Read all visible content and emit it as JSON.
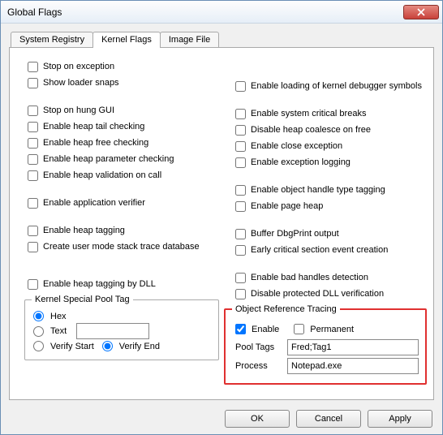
{
  "window": {
    "title": "Global Flags"
  },
  "tabs": {
    "system_registry": "System Registry",
    "kernel_flags": "Kernel Flags",
    "image_file": "Image File",
    "active": "kernel_flags"
  },
  "flags_left": {
    "stop_on_exception": "Stop on exception",
    "show_loader_snaps": "Show loader snaps",
    "stop_on_hung_gui": "Stop on hung GUI",
    "enable_heap_tail_checking": "Enable heap tail checking",
    "enable_heap_free_checking": "Enable heap free checking",
    "enable_heap_parameter_checking": "Enable heap parameter checking",
    "enable_heap_validation_on_call": "Enable heap validation on call",
    "enable_application_verifier": "Enable application verifier",
    "enable_heap_tagging": "Enable heap tagging",
    "create_user_mode_stack_trace_db": "Create user mode stack trace database",
    "enable_heap_tagging_by_dll": "Enable heap tagging by DLL"
  },
  "flags_right": {
    "enable_loading_kernel_debugger_symbols": "Enable loading of kernel debugger symbols",
    "enable_system_critical_breaks": "Enable system critical breaks",
    "disable_heap_coalesce_on_free": "Disable heap coalesce on free",
    "enable_close_exception": "Enable close exception",
    "enable_exception_logging": "Enable exception logging",
    "enable_object_handle_type_tagging": "Enable object handle type tagging",
    "enable_page_heap": "Enable page heap",
    "buffer_dbgprint_output": "Buffer DbgPrint output",
    "early_critical_section_event_creation": "Early critical section event creation",
    "enable_bad_handles_detection": "Enable bad handles detection",
    "disable_protected_dll_verification": "Disable protected DLL verification"
  },
  "kernel_special_pool_tag": {
    "legend": "Kernel Special Pool Tag",
    "hex": "Hex",
    "text": "Text",
    "verify_start": "Verify Start",
    "verify_end": "Verify End",
    "text_value": "",
    "selected_format": "hex",
    "selected_verify": "verify_end"
  },
  "object_reference_tracing": {
    "legend": "Object Reference Tracing",
    "enable": "Enable",
    "enable_checked": true,
    "permanent": "Permanent",
    "permanent_checked": false,
    "pool_tags_label": "Pool Tags",
    "pool_tags_value": "Fred;Tag1",
    "process_label": "Process",
    "process_value": "Notepad.exe"
  },
  "buttons": {
    "ok": "OK",
    "cancel": "Cancel",
    "apply": "Apply"
  }
}
